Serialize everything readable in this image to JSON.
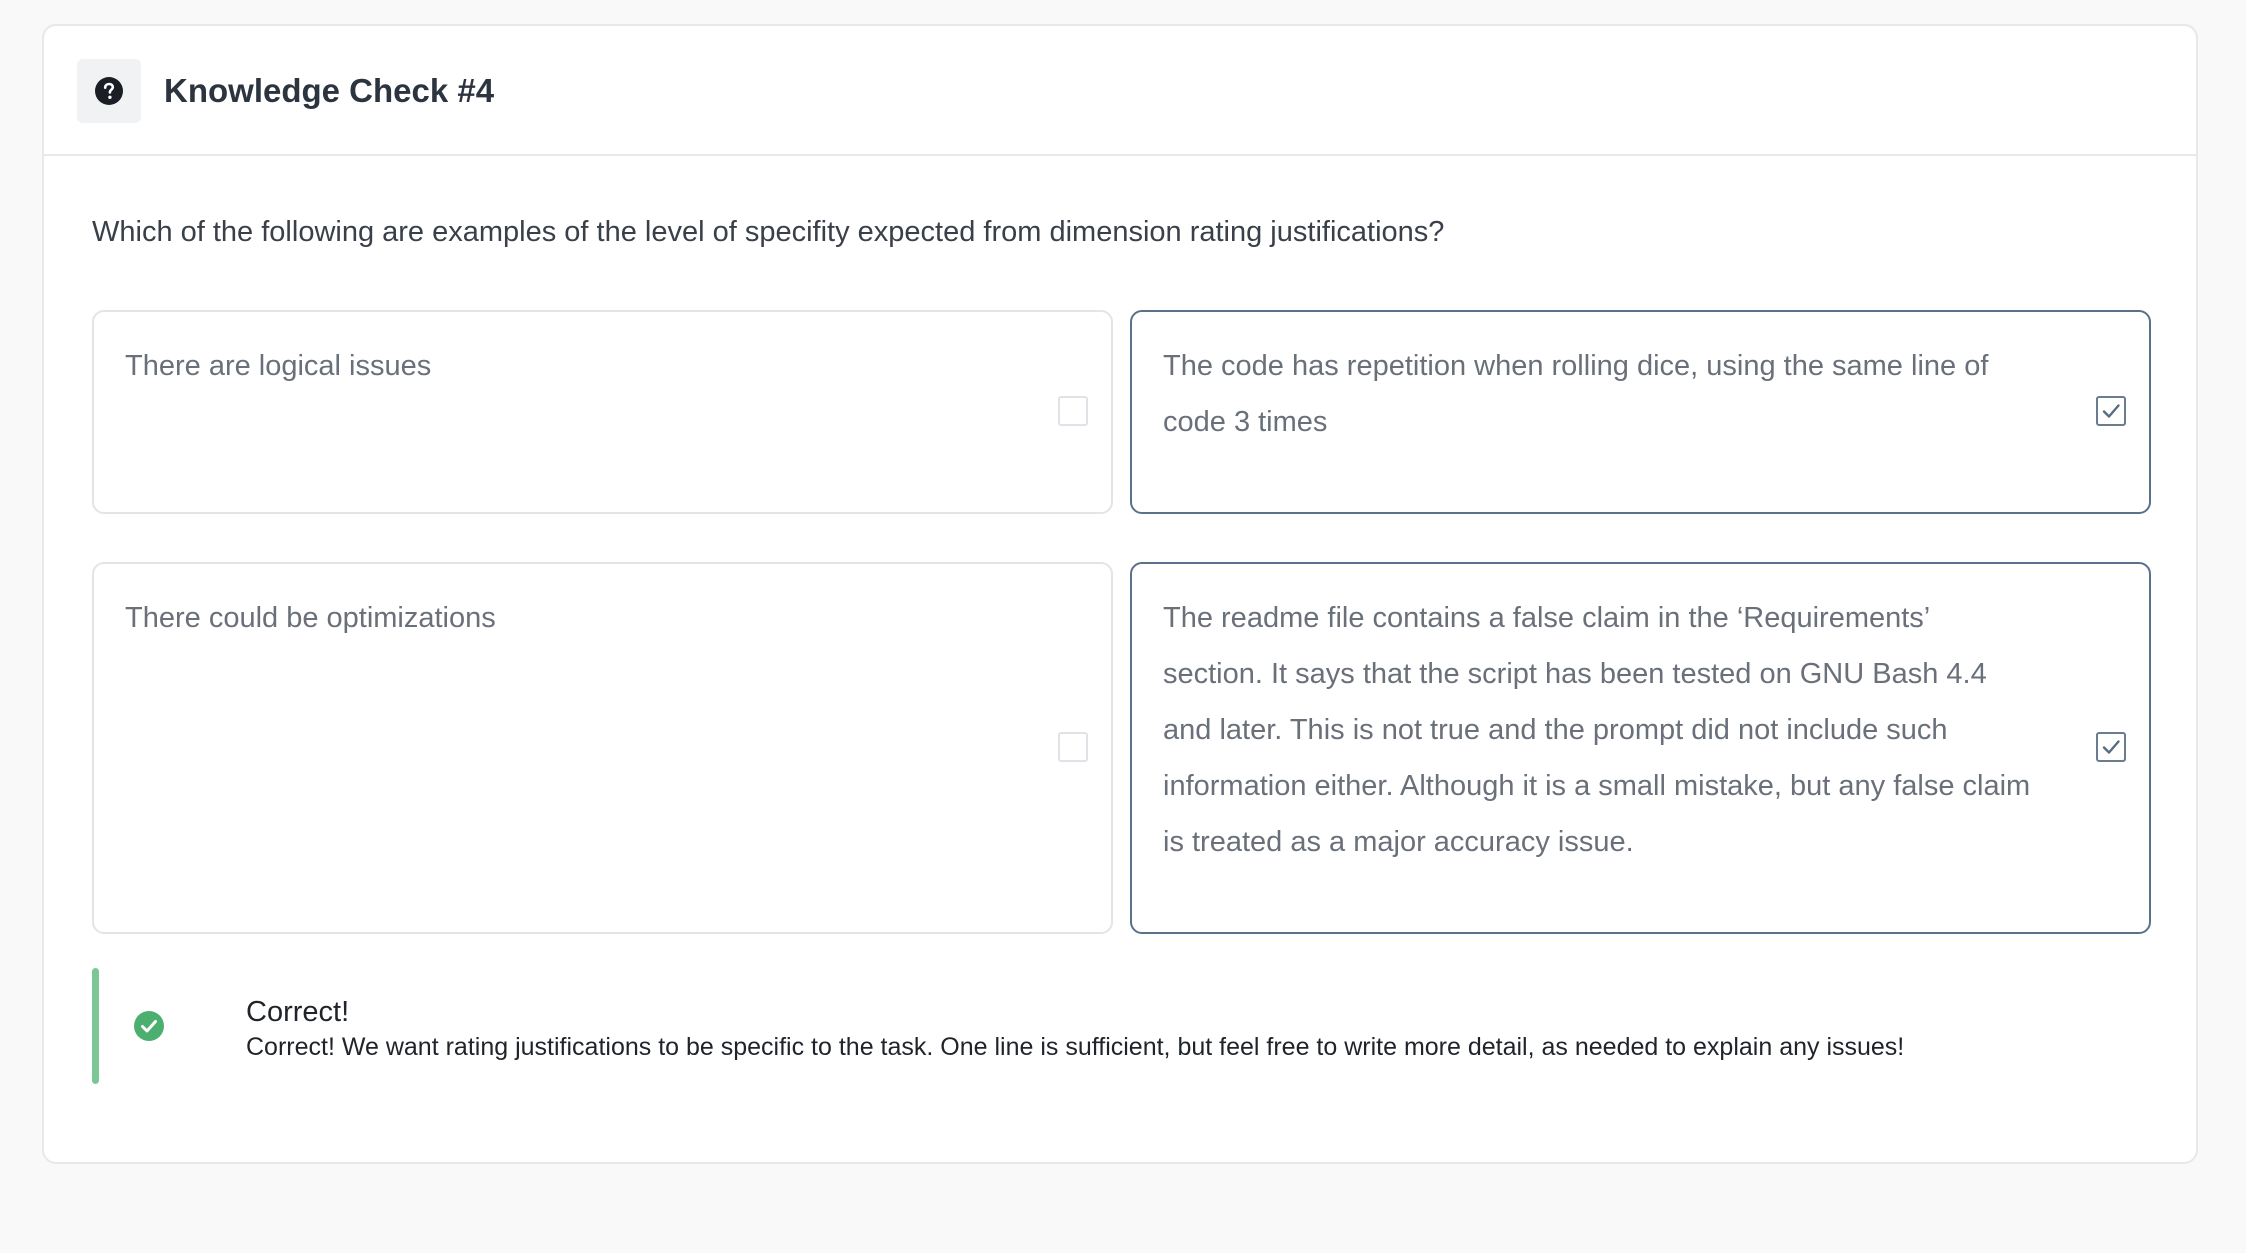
{
  "header": {
    "icon": "question-circle-icon",
    "title": "Knowledge Check #4"
  },
  "question": "Which of the following are examples of the level of specifity expected from dimension rating justifications?",
  "options": [
    {
      "text": "There are logical issues",
      "checked": false
    },
    {
      "text": "The code has repetition when rolling dice, using the same line of code 3 times",
      "checked": true
    },
    {
      "text": "There could be optimizations",
      "checked": false
    },
    {
      "text": "The readme file contains a false claim in the ‘Requirements’ section. It says that the script has been tested on GNU Bash 4.4 and later. This is not true and the prompt did not include such information either. Although it is a small mistake, but any false claim is treated as a major accuracy issue.",
      "checked": true
    }
  ],
  "feedback": {
    "icon": "check-circle-icon",
    "title": "Correct!",
    "message": "Correct! We want rating justifications to be specific to the task. One line is sufficient, but feel free to write more detail, as needed to explain any issues!"
  },
  "colors": {
    "success": "#4caf6f",
    "selected_border": "#5b708a"
  }
}
